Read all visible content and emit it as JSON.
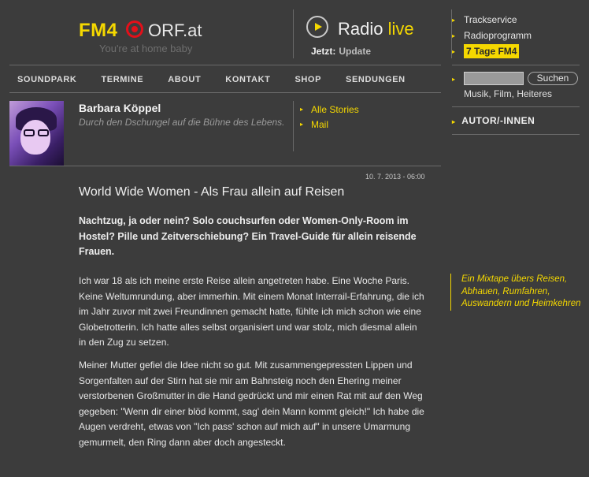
{
  "header": {
    "logo": "FM4",
    "orf": "ORF.at",
    "tagline": "You're at home baby",
    "radio": "Radio",
    "live": "live",
    "now_label": "Jetzt:",
    "now_value": "Update"
  },
  "side_links": [
    {
      "label": "Trackservice"
    },
    {
      "label": "Radioprogramm"
    },
    {
      "label": "7 Tage FM4"
    }
  ],
  "nav": [
    "SOUNDPARK",
    "TERMINE",
    "ABOUT",
    "KONTAKT",
    "SHOP",
    "SENDUNGEN"
  ],
  "search": {
    "placeholder": "",
    "button": "Suchen",
    "hint": "Musik, Film, Heiteres"
  },
  "author_heading": "AUTOR/-INNEN",
  "author": {
    "name": "Barbara Köppel",
    "description": "Durch den Dschungel auf die Bühne des Lebens."
  },
  "author_links": [
    "Alle Stories",
    "Mail"
  ],
  "article": {
    "date": "10. 7. 2013 - 06:00",
    "title": "World Wide Women - Als Frau allein auf Reisen",
    "lead": "Nachtzug, ja oder nein? Solo couchsurfen oder Women-Only-Room im Hostel? Pille und Zeitverschiebung? Ein Travel-Guide für allein reisende Frauen.",
    "paragraphs": [
      "Ich war 18 als ich meine erste Reise allein angetreten habe. Eine Woche Paris. Keine Weltumrundung, aber immerhin. Mit einem Monat Interrail-Erfahrung, die ich im Jahr zuvor mit zwei Freundinnen gemacht hatte, fühlte ich mich schon wie eine Globetrotterin. Ich hatte alles selbst organisiert und war stolz, mich diesmal allein in den Zug zu setzen.",
      "Meiner Mutter gefiel die Idee nicht so gut. Mit zusammengepressten Lippen und Sorgenfalten auf der Stirn hat sie mir am Bahnsteig noch den Ehering meiner verstorbenen Großmutter in die Hand gedrückt und mir einen Rat mit auf den Weg gegeben: \"Wenn dir einer blöd kommt, sag' dein Mann kommt gleich!\" Ich habe die Augen verdreht, etwas von \"Ich pass' schon auf mich auf\" in unsere Umarmung gemurmelt, den Ring dann aber doch angesteckt."
    ]
  },
  "aside": "Ein Mixtape übers Reisen, Abhauen, Rumfahren, Auswandern und Heimkehren",
  "colors": {
    "background": "#3c3c3c",
    "accent": "#f5d800",
    "logo_red": "#e3101a"
  }
}
